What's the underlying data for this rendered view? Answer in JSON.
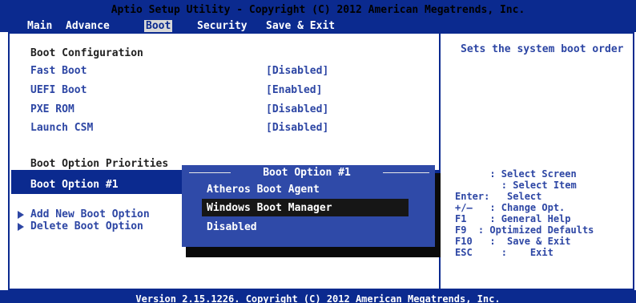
{
  "header": {
    "title": "Aptio Setup Utility - Copyright (C) 2012 American Megatrends, Inc.",
    "tabs": [
      "Main",
      "Advance",
      "Boot",
      "Security",
      "Save & Exit"
    ],
    "active_tab": "Boot"
  },
  "left": {
    "boot_config_heading": "Boot Configuration",
    "rows": [
      {
        "label": "Fast Boot",
        "value": "[Disabled]"
      },
      {
        "label": "UEFI Boot",
        "value": "[Enabled]"
      },
      {
        "label": "PXE ROM",
        "value": "[Disabled]"
      },
      {
        "label": "Launch CSM",
        "value": "[Disabled]"
      }
    ],
    "priorities_heading": "Boot Option Priorities",
    "selected_item": "Boot Option #1",
    "add_new": "Add New Boot Option",
    "delete": "Delete Boot Option"
  },
  "help": {
    "description": "Sets the system boot order",
    "keys": [
      "      : Select Screen",
      "        : Select Item",
      "Enter:   Select",
      "+/—   : Change Opt.",
      "F1    : General Help",
      "F9  : Optimized Defaults",
      "F10   :  Save & Exit",
      "ESC     :    Exit"
    ]
  },
  "popup": {
    "title": "Boot Option #1",
    "options": [
      "Atheros Boot Agent",
      "Windows Boot Manager",
      "Disabled"
    ],
    "highlighted": "Windows Boot Manager"
  },
  "footer": {
    "text": "Version 2.15.1226. Copyright (C) 2012 American Megatrends, Inc."
  },
  "colors": {
    "bios_blue": "#0b2a8f",
    "item_blue": "#2d46a4",
    "popup_blue": "#2f4aa8",
    "highlight_dark": "#161616"
  }
}
